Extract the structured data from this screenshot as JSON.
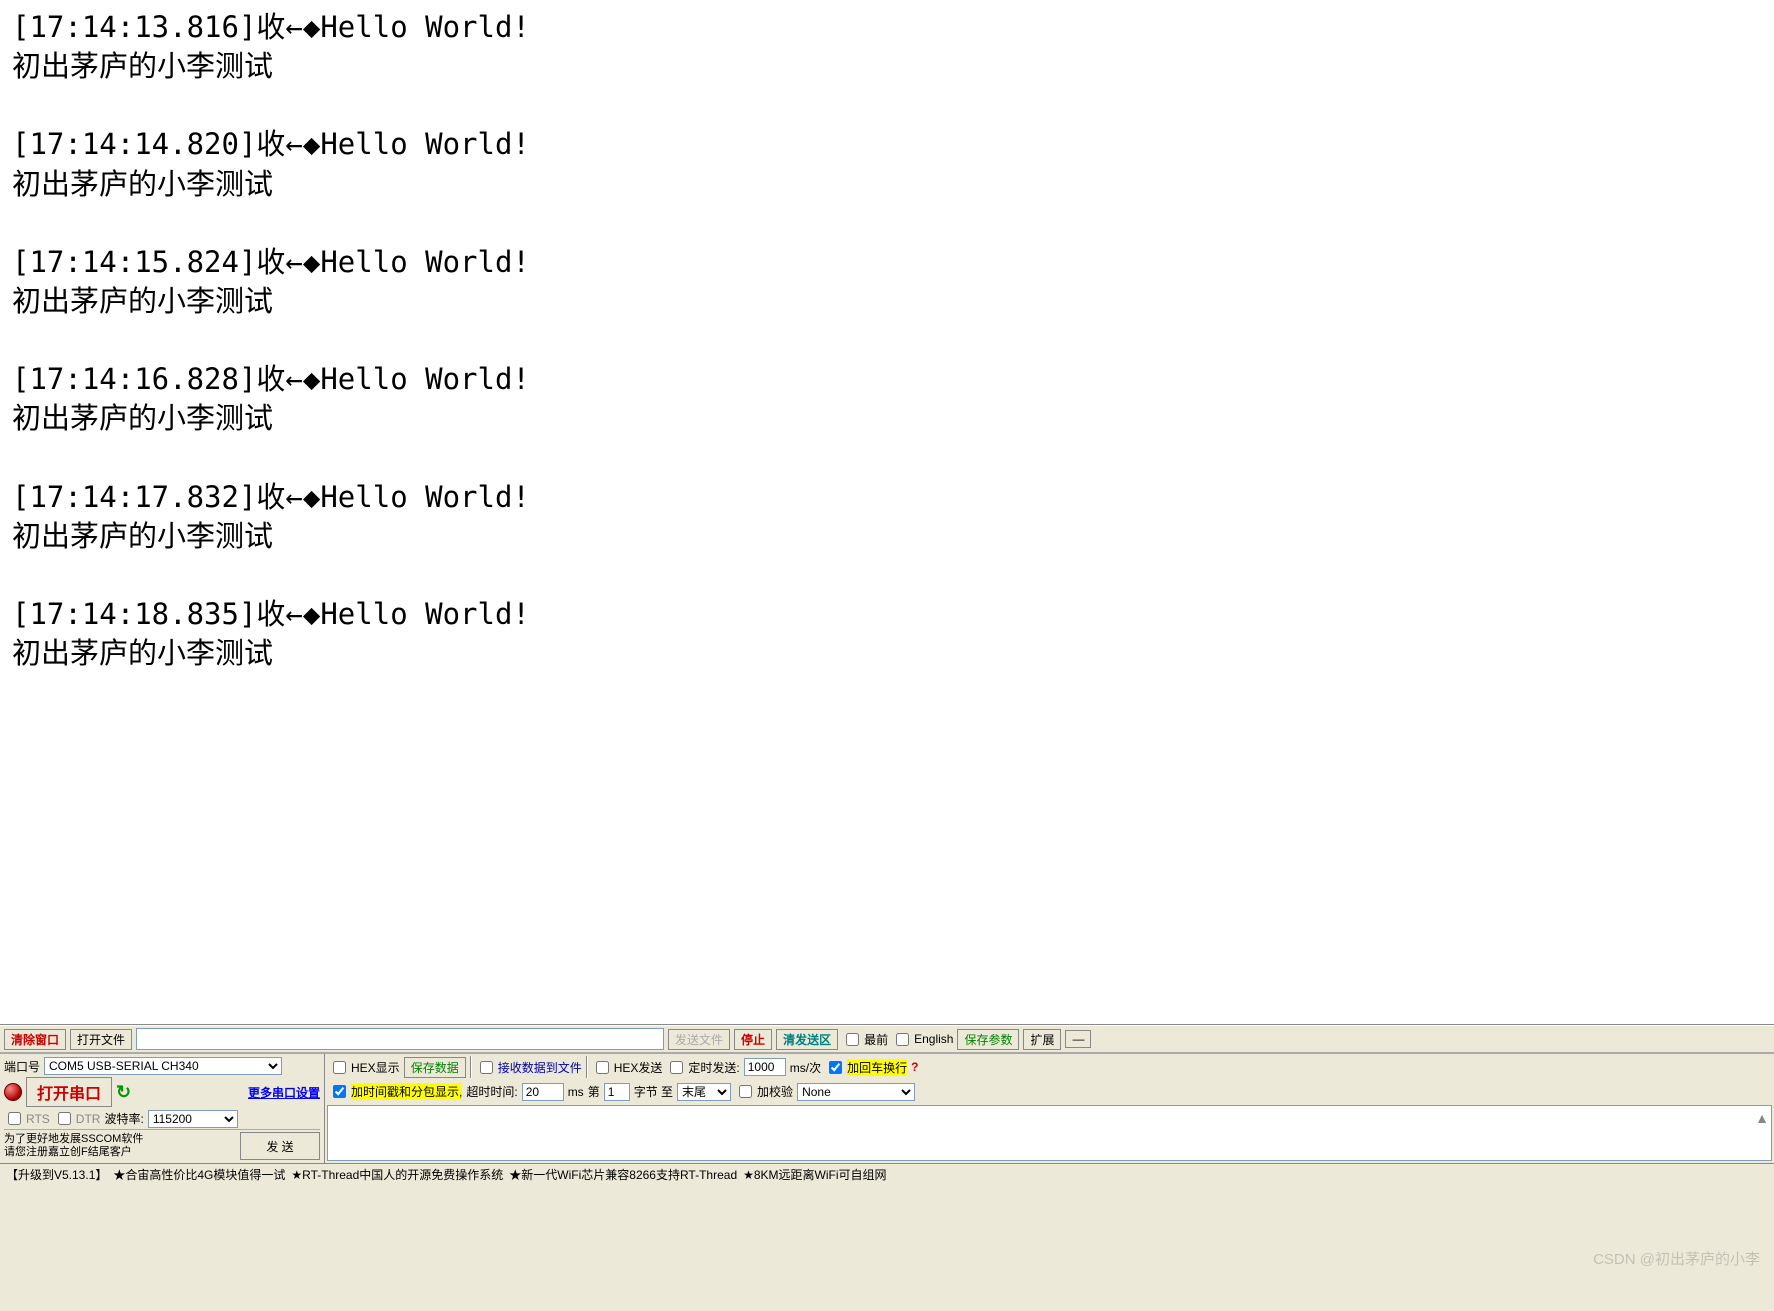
{
  "log_entries": [
    {
      "ts": "17:14:13.816",
      "dir": "收←◆",
      "msg": "Hello World!",
      "line2": "初出茅庐的小李测试"
    },
    {
      "ts": "17:14:14.820",
      "dir": "收←◆",
      "msg": "Hello World!",
      "line2": "初出茅庐的小李测试"
    },
    {
      "ts": "17:14:15.824",
      "dir": "收←◆",
      "msg": "Hello World!",
      "line2": "初出茅庐的小李测试"
    },
    {
      "ts": "17:14:16.828",
      "dir": "收←◆",
      "msg": "Hello World!",
      "line2": "初出茅庐的小李测试"
    },
    {
      "ts": "17:14:17.832",
      "dir": "收←◆",
      "msg": "Hello World!",
      "line2": "初出茅庐的小李测试"
    },
    {
      "ts": "17:14:18.835",
      "dir": "收←◆",
      "msg": "Hello World!",
      "line2": "初出茅庐的小李测试"
    }
  ],
  "toolbar1": {
    "clear_window": "清除窗口",
    "open_file": "打开文件",
    "send_file": "发送文件",
    "stop": "停止",
    "clear_send": "清发送区",
    "most_front": "最前",
    "english": "English",
    "save_params": "保存参数",
    "expand": "扩展",
    "minimize": "—"
  },
  "port": {
    "label": "端口号",
    "value": "COM5 USB-SERIAL CH340",
    "hex_display": "HEX显示",
    "save_data": "保存数据",
    "recv_to_file": "接收数据到文件",
    "hex_send": "HEX发送",
    "timed_send": "定时发送:",
    "interval": "1000",
    "unit": "ms/次",
    "add_crlf": "加回车换行"
  },
  "row3": {
    "open_port": "打开串口",
    "more_settings": "更多串口设置",
    "add_timestamp": "加时间戳和分包显示,",
    "timeout_label": "超时时间:",
    "timeout": "20",
    "ms": "ms",
    "nth_label": "第",
    "nth": "1",
    "byte_to": "字节 至",
    "tail": "末尾",
    "add_check": "加校验",
    "check_type": "None"
  },
  "row4": {
    "rts": "RTS",
    "dtr": "DTR",
    "baud_label": "波特率:",
    "baud": "115200"
  },
  "donate": {
    "line1": "为了更好地发展SSCOM软件",
    "line2": "请您注册嘉立创F结尾客户",
    "send_btn": "发 送"
  },
  "footer": {
    "upgrade": "【升级到V5.13.1】",
    "ad1": "★合宙高性价比4G模块值得一试",
    "ad2": "★RT-Thread中国人的开源免费操作系统",
    "ad3": "★新一代WiFi芯片兼容8266支持RT-Thread",
    "ad4": "★8KM远距离WiFi可自组网"
  },
  "watermark": "CSDN @初出茅庐的小李"
}
